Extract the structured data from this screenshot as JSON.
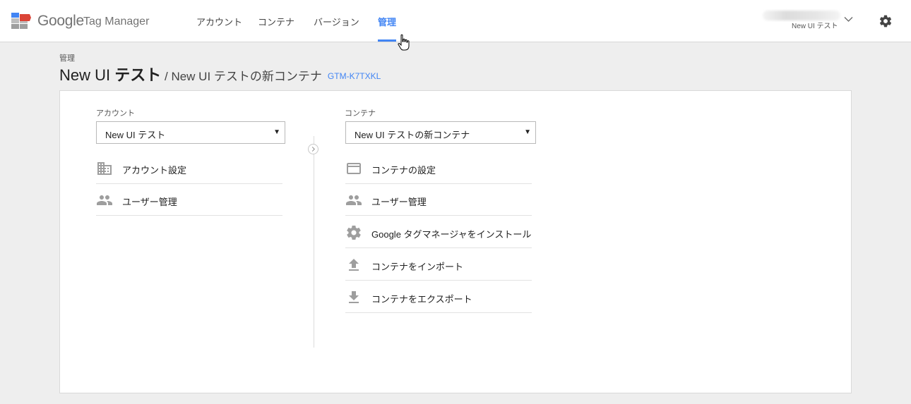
{
  "header": {
    "brand_google": "Google",
    "brand_product": "Tag Manager",
    "nav": [
      {
        "label": "アカウント"
      },
      {
        "label": "コンテナ"
      },
      {
        "label": "バージョン"
      },
      {
        "label": "管理",
        "active": true
      }
    ],
    "account_switcher": {
      "subtitle": "New UI テスト"
    },
    "icons": {
      "settings": "gear-icon",
      "account_menu": "chevron-down-icon"
    }
  },
  "breadcrumb": "管理",
  "title": {
    "account_regular": "New UI ",
    "account_bold": "テスト",
    "separator": " / ",
    "container": "New UI テストの新コンテナ",
    "public_id": "GTM-K7TXKL"
  },
  "account_column": {
    "label": "アカウント",
    "selected": "New UI テスト",
    "items": [
      {
        "label": "アカウント設定",
        "icon": "building-icon"
      },
      {
        "label": "ユーザー管理",
        "icon": "people-icon"
      }
    ]
  },
  "container_column": {
    "label": "コンテナ",
    "selected": "New UI テストの新コンテナ",
    "items": [
      {
        "label": "コンテナの設定",
        "icon": "container-icon"
      },
      {
        "label": "ユーザー管理",
        "icon": "people-icon"
      },
      {
        "label": "Google タグマネージャをインストール",
        "icon": "gear-icon"
      },
      {
        "label": "コンテナをインポート",
        "icon": "upload-icon"
      },
      {
        "label": "コンテナをエクスポート",
        "icon": "download-icon"
      }
    ]
  },
  "colors": {
    "accent": "#4285f4",
    "background": "#eeeeee",
    "icon": "#9e9e9e"
  }
}
